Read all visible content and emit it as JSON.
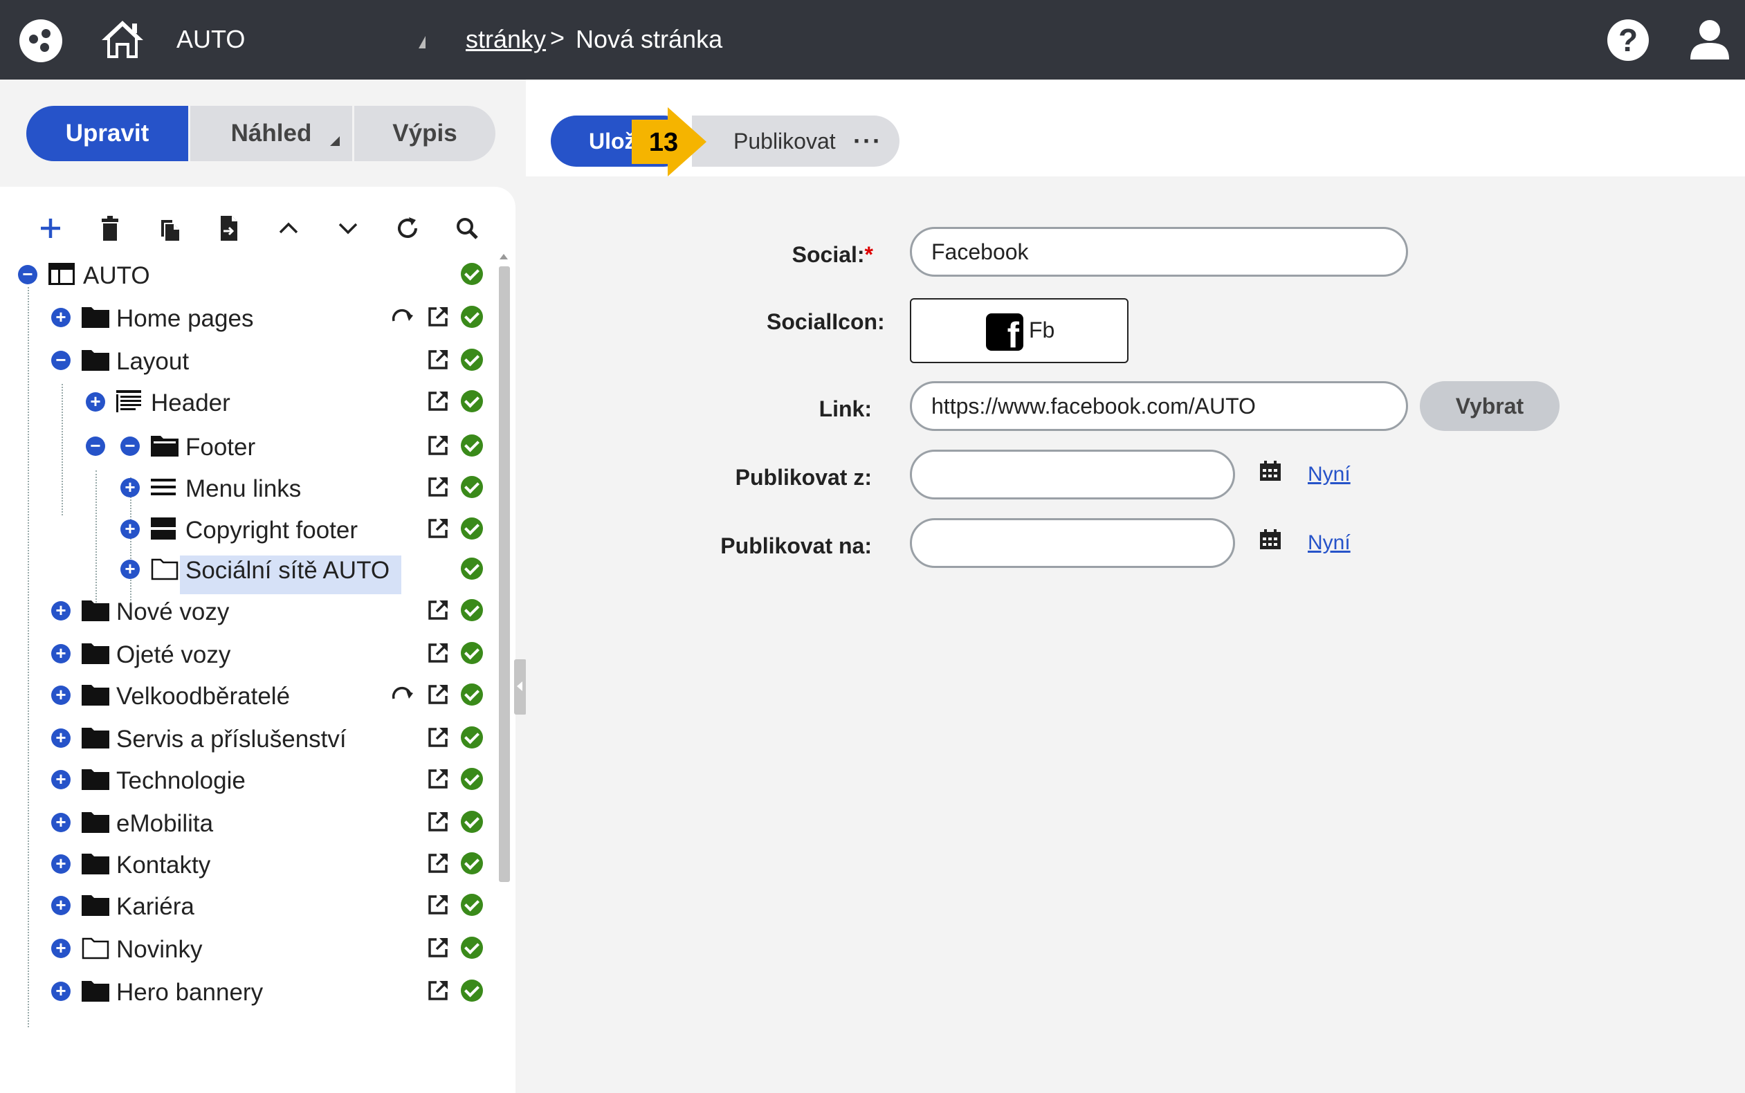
{
  "topbar": {
    "domain": "AUTO",
    "breadcrumb_link": "stránky",
    "breadcrumb_sep": ">",
    "breadcrumb_current": "Nová stránka",
    "help": "?"
  },
  "modes": [
    {
      "label": "Upravit"
    },
    {
      "label": "Náhled"
    },
    {
      "label": "Výpis"
    }
  ],
  "toolbar_icons": [
    "plus-icon",
    "trash-icon",
    "copy-icon",
    "move-icon",
    "chevron-up-icon",
    "chevron-down-icon",
    "refresh-icon",
    "search-icon"
  ],
  "tree": {
    "root": "AUTO",
    "home_pages": "Home pages",
    "layout": "Layout",
    "header": "Header",
    "footer": "Footer",
    "menu_links": "Menu links",
    "copyright_footer": "Copyright footer",
    "socialni_site": "Sociální sítě AUTO",
    "nove_vozy": "Nové vozy",
    "ojete_vozy": "Ojeté vozy",
    "velkoodberatele": "Velkoodběratelé",
    "servis": "Servis a příslušenství",
    "technologie": "Technologie",
    "emobilita": "eMobilita",
    "kontakty": "Kontakty",
    "kariera": "Kariéra",
    "novinky": "Novinky",
    "hero_bannery": "Hero bannery"
  },
  "actions": {
    "save": "Ulož",
    "publish": "Publikovat",
    "more": "···",
    "marker_number": "13"
  },
  "form": {
    "social_label": "Social:",
    "required_mark": "*",
    "social_value": "Facebook",
    "socialicon_label": "SocialIcon:",
    "socialicon_text": "Fb",
    "link_label": "Link:",
    "link_value": "https://www.facebook.com/AUTO",
    "vybrat": "Vybrat",
    "publish_from_label": "Publikovat z:",
    "publish_to_label": "Publikovat na:",
    "now_link": "Nyní"
  },
  "colors": {
    "topbar": "#33363d",
    "primary": "#2653c9",
    "ok": "#3a8a1a",
    "marker": "#f5b400"
  }
}
